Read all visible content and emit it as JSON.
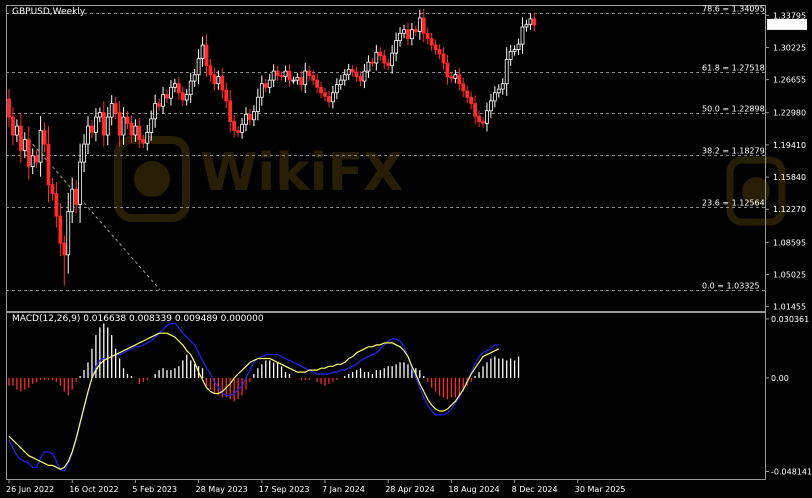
{
  "chart_data": {
    "type": "candlestick",
    "title": "GBPUSD,Weekly",
    "colors": {
      "background": "#000000",
      "bull": "#ffffff",
      "bear": "#ff2a2a",
      "grid_dash": "#8a8a8a",
      "macd_signal": "#ffff66",
      "macd_line": "#2323ff",
      "price_tag_bg": "#ffffff",
      "price_tag_text": "#000000"
    },
    "price_axis": {
      "ylim": [
        1.0097,
        1.3483
      ],
      "ticks": [
        "1.33795",
        "1.30225",
        "1.26655",
        "1.22980",
        "1.19410",
        "1.15840",
        "1.12270",
        "1.08595",
        "1.05025",
        "1.01455"
      ],
      "tick_values": [
        1.33795,
        1.30225,
        1.26655,
        1.2298,
        1.1941,
        1.1584,
        1.1227,
        1.08595,
        1.05025,
        1.01455
      ],
      "current_price_label": "1.32733",
      "current_price": 1.32733
    },
    "fibonacci_levels": [
      {
        "label": "78.6 = 1.34095",
        "value": 1.34095
      },
      {
        "label": "61.8 = 1.27518",
        "value": 1.27518
      },
      {
        "label": "50.0 = 1.22898",
        "value": 1.22898
      },
      {
        "label": "38.2 = 1.18279",
        "value": 1.18279
      },
      {
        "label": "23.6 = 1.12564",
        "value": 1.12564
      },
      {
        "label": "0.0 = 1.03325",
        "value": 1.03325
      }
    ],
    "x_axis": {
      "labels": [
        "26 Jun 2022",
        "16 Oct 2022",
        "5 Feb 2023",
        "28 May 2023",
        "17 Sep 2023",
        "7 Jan 2024",
        "28 Apr 2024",
        "18 Aug 2024",
        "8 Dec 2024",
        "30 Mar 2025"
      ],
      "label_bar_index": [
        0,
        16,
        32,
        48,
        64,
        80,
        96,
        112,
        128,
        144
      ]
    },
    "candles_close": [
      1.225,
      1.205,
      1.215,
      1.188,
      1.2,
      1.17,
      1.182,
      1.175,
      1.21,
      1.195,
      1.15,
      1.14,
      1.115,
      1.085,
      1.072,
      1.12,
      1.145,
      1.128,
      1.175,
      1.195,
      1.215,
      1.208,
      1.225,
      1.23,
      1.205,
      1.225,
      1.24,
      1.23,
      1.205,
      1.225,
      1.218,
      1.205,
      1.215,
      1.2,
      1.196,
      1.208,
      1.223,
      1.24,
      1.237,
      1.25,
      1.246,
      1.258,
      1.262,
      1.252,
      1.244,
      1.25,
      1.265,
      1.272,
      1.29,
      1.305,
      1.282,
      1.272,
      1.262,
      1.27,
      1.255,
      1.243,
      1.22,
      1.21,
      1.208,
      1.217,
      1.228,
      1.222,
      1.231,
      1.247,
      1.262,
      1.258,
      1.266,
      1.276,
      1.271,
      1.27,
      1.276,
      1.266,
      1.266,
      1.269,
      1.261,
      1.276,
      1.271,
      1.266,
      1.258,
      1.252,
      1.248,
      1.242,
      1.252,
      1.261,
      1.266,
      1.272,
      1.278,
      1.275,
      1.27,
      1.265,
      1.276,
      1.286,
      1.285,
      1.297,
      1.293,
      1.285,
      1.282,
      1.296,
      1.31,
      1.318,
      1.322,
      1.312,
      1.322,
      1.32,
      1.335,
      1.318,
      1.312,
      1.305,
      1.3,
      1.295,
      1.285,
      1.27,
      1.268,
      1.272,
      1.262,
      1.254,
      1.247,
      1.24,
      1.226,
      1.22,
      1.218,
      1.232,
      1.243,
      1.252,
      1.256,
      1.262,
      1.289,
      1.298,
      1.3,
      1.306,
      1.325,
      1.328,
      1.334,
      1.327
    ],
    "candles_open_note": "open = previous close",
    "macd": {
      "label": "MACD(12,26,9) 0.016638 0.008339 0.009489 0.000000",
      "ylim": [
        -0.052,
        0.0334
      ],
      "ticks": [
        "0.030361",
        "0.00",
        "-0.048141"
      ],
      "tick_values": [
        0.030361,
        0.0,
        -0.048141
      ],
      "histogram": [
        -0.004,
        -0.004,
        -0.006,
        -0.007,
        -0.006,
        -0.005,
        -0.003,
        -0.002,
        -0.001,
        -0.001,
        -0.001,
        -0.001,
        -0.002,
        -0.004,
        -0.007,
        -0.009,
        -0.006,
        -0.002,
        0.001,
        0.004,
        0.008,
        0.015,
        0.022,
        0.026,
        0.028,
        0.026,
        0.022,
        0.015,
        0.01,
        0.005,
        0.002,
        0.001,
        0.0,
        -0.003,
        -0.002,
        -0.001,
        0.0,
        0.002,
        0.004,
        0.005,
        0.004,
        0.004,
        0.005,
        0.006,
        0.009,
        0.012,
        0.009,
        0.007,
        0.006,
        0.005,
        -0.004,
        -0.006,
        -0.008,
        -0.009,
        -0.01,
        -0.01,
        -0.011,
        -0.012,
        -0.011,
        -0.009,
        -0.006,
        -0.002,
        0.002,
        0.005,
        0.007,
        0.009,
        0.009,
        0.008,
        0.008,
        0.006,
        0.003,
        0.002,
        0.0,
        0.0,
        -0.001,
        -0.001,
        -0.001,
        0.0,
        -0.002,
        -0.003,
        -0.004,
        -0.003,
        -0.002,
        -0.001,
        0.0,
        0.001,
        0.002,
        0.003,
        0.004,
        0.005,
        0.003,
        0.003,
        0.002,
        0.004,
        0.004,
        0.005,
        0.006,
        0.006,
        0.007,
        0.008,
        0.008,
        0.007,
        0.006,
        0.005,
        0.004,
        0.001,
        -0.002,
        -0.005,
        -0.007,
        -0.009,
        -0.01,
        -0.011,
        -0.01,
        -0.01,
        -0.009,
        -0.007,
        -0.004,
        -0.002,
        0.001,
        0.003,
        0.006,
        0.008,
        0.01,
        0.011,
        0.01,
        0.01,
        0.009,
        0.01,
        0.009,
        0.011
      ],
      "main_line": [
        -0.032,
        -0.036,
        -0.04,
        -0.042,
        -0.043,
        -0.044,
        -0.046,
        -0.046,
        -0.041,
        -0.038,
        -0.038,
        -0.039,
        -0.043,
        -0.047,
        -0.048,
        -0.044,
        -0.039,
        -0.032,
        -0.024,
        -0.016,
        -0.008,
        0.0,
        0.006,
        0.009,
        0.01,
        0.01,
        0.011,
        0.012,
        0.012,
        0.013,
        0.014,
        0.015,
        0.016,
        0.016,
        0.017,
        0.018,
        0.019,
        0.021,
        0.023,
        0.025,
        0.027,
        0.028,
        0.028,
        0.026,
        0.023,
        0.021,
        0.019,
        0.017,
        0.013,
        0.009,
        0.005,
        0.002,
        -0.002,
        -0.005,
        -0.008,
        -0.009,
        -0.009,
        -0.008,
        -0.006,
        -0.004,
        0.0,
        0.004,
        0.008,
        0.01,
        0.011,
        0.012,
        0.012,
        0.012,
        0.012,
        0.011,
        0.01,
        0.009,
        0.008,
        0.007,
        0.006,
        0.005,
        0.004,
        0.003,
        0.002,
        0.002,
        0.002,
        0.002,
        0.003,
        0.003,
        0.004,
        0.004,
        0.005,
        0.006,
        0.007,
        0.009,
        0.01,
        0.011,
        0.012,
        0.013,
        0.015,
        0.017,
        0.019,
        0.02,
        0.02,
        0.019,
        0.016,
        0.011,
        0.005,
        0.0,
        -0.005,
        -0.01,
        -0.014,
        -0.017,
        -0.019,
        -0.019,
        -0.019,
        -0.018,
        -0.016,
        -0.013,
        -0.01,
        -0.006,
        -0.002,
        0.003,
        0.007,
        0.011,
        0.013,
        0.014,
        0.015,
        0.017,
        0.017
      ],
      "signal_line": [
        -0.03,
        -0.032,
        -0.034,
        -0.036,
        -0.038,
        -0.04,
        -0.041,
        -0.042,
        -0.043,
        -0.044,
        -0.045,
        -0.045,
        -0.046,
        -0.047,
        -0.046,
        -0.043,
        -0.038,
        -0.031,
        -0.023,
        -0.015,
        -0.007,
        0.0,
        0.004,
        0.007,
        0.009,
        0.01,
        0.011,
        0.012,
        0.013,
        0.014,
        0.015,
        0.016,
        0.017,
        0.018,
        0.019,
        0.02,
        0.021,
        0.022,
        0.023,
        0.023,
        0.023,
        0.022,
        0.021,
        0.019,
        0.017,
        0.014,
        0.012,
        0.008,
        0.003,
        -0.001,
        -0.005,
        -0.007,
        -0.008,
        -0.008,
        -0.007,
        -0.005,
        -0.003,
        0.0,
        0.002,
        0.004,
        0.006,
        0.008,
        0.009,
        0.01,
        0.01,
        0.01,
        0.01,
        0.009,
        0.008,
        0.007,
        0.006,
        0.005,
        0.004,
        0.003,
        0.003,
        0.003,
        0.004,
        0.004,
        0.004,
        0.005,
        0.005,
        0.006,
        0.006,
        0.007,
        0.007,
        0.008,
        0.01,
        0.011,
        0.013,
        0.014,
        0.015,
        0.016,
        0.016,
        0.017,
        0.017,
        0.018,
        0.018,
        0.018,
        0.017,
        0.016,
        0.014,
        0.011,
        0.006,
        0.002,
        -0.003,
        -0.007,
        -0.011,
        -0.014,
        -0.016,
        -0.017,
        -0.017,
        -0.016,
        -0.014,
        -0.012,
        -0.009,
        -0.006,
        -0.002,
        0.002,
        0.005,
        0.008,
        0.011,
        0.012,
        0.013,
        0.014,
        0.015
      ]
    }
  },
  "watermark": {
    "text": "WikiFX"
  }
}
